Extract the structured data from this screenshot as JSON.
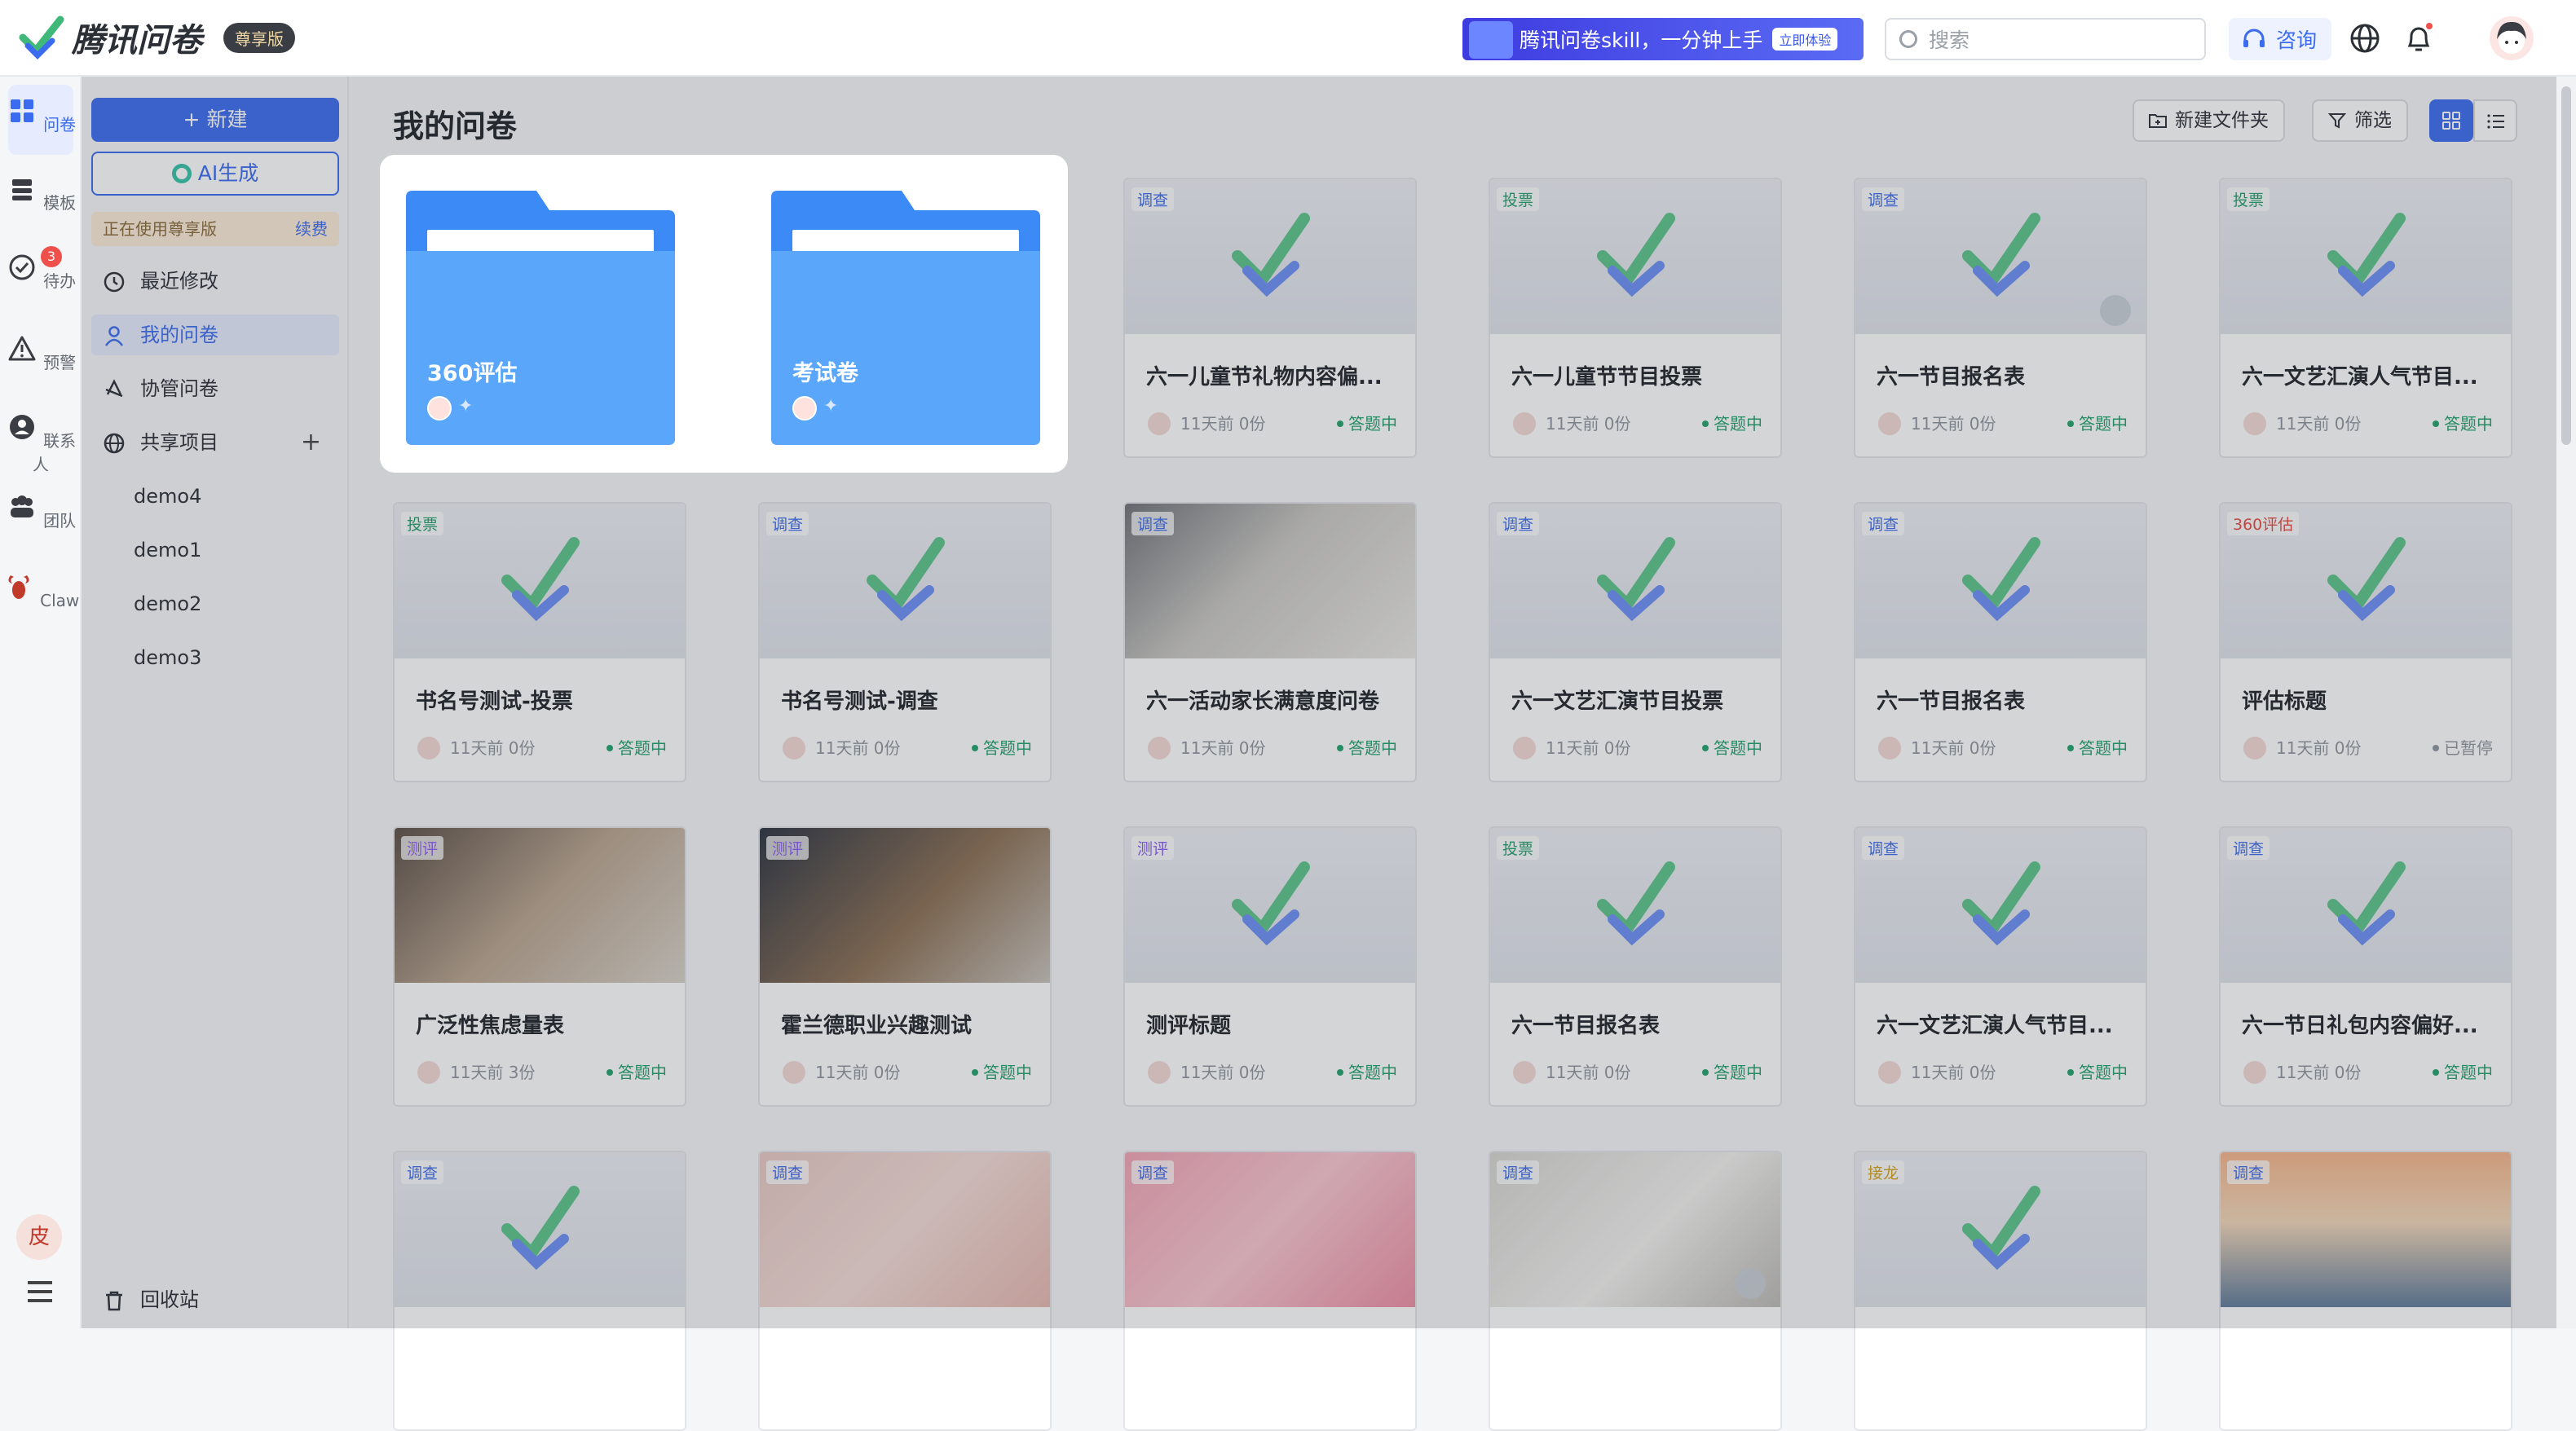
{
  "app": {
    "name": "腾讯问卷",
    "edition": "尊享版",
    "banner_text": "腾讯问卷skill，一分钟上手",
    "banner_cta": "立即体验",
    "search_placeholder": "搜索",
    "consult": "咨询",
    "notification_dot": true
  },
  "rail": [
    {
      "label": "问卷",
      "icon": "grid-icon",
      "active": true
    },
    {
      "label": "模板",
      "icon": "stack-icon"
    },
    {
      "label": "待办",
      "icon": "todo-icon",
      "badge": "3"
    },
    {
      "label": "预警",
      "icon": "warning-icon"
    },
    {
      "label": "联系人",
      "icon": "contact-icon"
    },
    {
      "label": "团队",
      "icon": "team-icon"
    },
    {
      "label": "Claw",
      "icon": "claw-icon"
    }
  ],
  "rail_avatar": "皮",
  "sidebar": {
    "new_label": "+ 新建",
    "ai_label": "AI生成",
    "tier_text": "正在使用尊享版",
    "renew": "续费",
    "nav": [
      {
        "label": "最近修改",
        "icon": "history-icon"
      },
      {
        "label": "我的问卷",
        "icon": "user-icon",
        "active": true
      },
      {
        "label": "协管问卷",
        "icon": "collab-icon"
      },
      {
        "label": "共享项目",
        "icon": "globe-icon"
      }
    ],
    "projects": [
      "demo4",
      "demo1",
      "demo2",
      "demo3"
    ],
    "trash": "回收站"
  },
  "main": {
    "title": "我的问卷",
    "new_folder": "新建文件夹",
    "filter": "筛选"
  },
  "folders": [
    {
      "title": "360评估"
    },
    {
      "title": "考试卷"
    }
  ],
  "cards": [
    {
      "tag": "调查",
      "title": "六一儿童节礼物内容偏...",
      "meta": "11天前 0份",
      "status": "答题中"
    },
    {
      "tag": "投票",
      "title": "六一儿童节节目投票",
      "meta": "11天前 0份",
      "status": "答题中"
    },
    {
      "tag": "调查",
      "title": "六一节目报名表",
      "meta": "11天前 0份",
      "status": "答题中"
    },
    {
      "tag": "投票",
      "title": "六一文艺汇演人气节目...",
      "meta": "11天前 0份",
      "status": "答题中"
    },
    {
      "tag": "投票",
      "title": "书名号测试-投票",
      "meta": "11天前 0份",
      "status": "答题中"
    },
    {
      "tag": "调查",
      "title": "书名号测试-调查",
      "meta": "11天前 0份",
      "status": "答题中"
    },
    {
      "tag": "调查",
      "title": "六一活动家长满意度问卷",
      "meta": "11天前 0份",
      "status": "答题中"
    },
    {
      "tag": "调查",
      "title": "六一文艺汇演节目投票",
      "meta": "11天前 0份",
      "status": "答题中"
    },
    {
      "tag": "调查",
      "title": "六一节目报名表",
      "meta": "11天前 0份",
      "status": "答题中"
    },
    {
      "tag": "360评估",
      "title": "评估标题",
      "meta": "11天前 0份",
      "status": "已暂停"
    },
    {
      "tag": "测评",
      "title": "广泛性焦虑量表",
      "meta": "11天前 3份",
      "status": "答题中"
    },
    {
      "tag": "测评",
      "title": "霍兰德职业兴趣测试",
      "meta": "11天前 0份",
      "status": "答题中"
    },
    {
      "tag": "测评",
      "title": "测评标题",
      "meta": "11天前 0份",
      "status": "答题中"
    },
    {
      "tag": "投票",
      "title": "六一节目报名表",
      "meta": "11天前 0份",
      "status": "答题中"
    },
    {
      "tag": "调查",
      "title": "六一文艺汇演人气节目...",
      "meta": "11天前 0份",
      "status": "答题中"
    },
    {
      "tag": "调查",
      "title": "六一节日礼包内容偏好...",
      "meta": "11天前 0份",
      "status": "答题中"
    },
    {
      "tag": "调查",
      "title": "",
      "meta": "",
      "status": ""
    },
    {
      "tag": "调查",
      "title": "",
      "meta": "",
      "status": ""
    },
    {
      "tag": "调查",
      "title": "",
      "meta": "",
      "status": ""
    },
    {
      "tag": "调查",
      "title": "",
      "meta": "",
      "status": ""
    },
    {
      "tag": "接龙",
      "title": "",
      "meta": "",
      "status": ""
    },
    {
      "tag": "调查",
      "title": "",
      "meta": "",
      "status": ""
    }
  ]
}
